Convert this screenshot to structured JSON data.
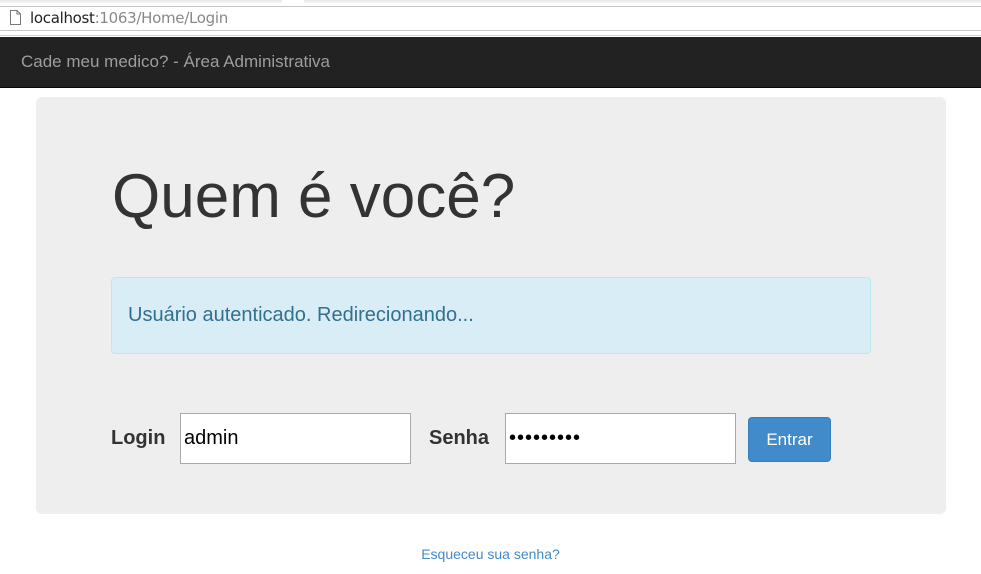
{
  "browser": {
    "url_host": "localhost",
    "url_path": ":1063/Home/Login",
    "page_icon": "page-icon"
  },
  "navbar": {
    "brand": "Cade meu medico? - Área Administrativa"
  },
  "login": {
    "title": "Quem é você?",
    "alert_message": "Usuário autenticado. Redirecionando...",
    "login_label": "Login",
    "login_value": "admin",
    "senha_label": "Senha",
    "senha_value": "123456789",
    "submit_label": "Entrar",
    "forgot_password": "Esqueceu sua senha?"
  },
  "colors": {
    "navbar_bg": "#222222",
    "brand_text": "#9d9d9d",
    "jumbotron_bg": "#eeeeee",
    "alert_bg": "#d9edf7",
    "alert_text": "#31708f",
    "primary": "#428bca"
  }
}
